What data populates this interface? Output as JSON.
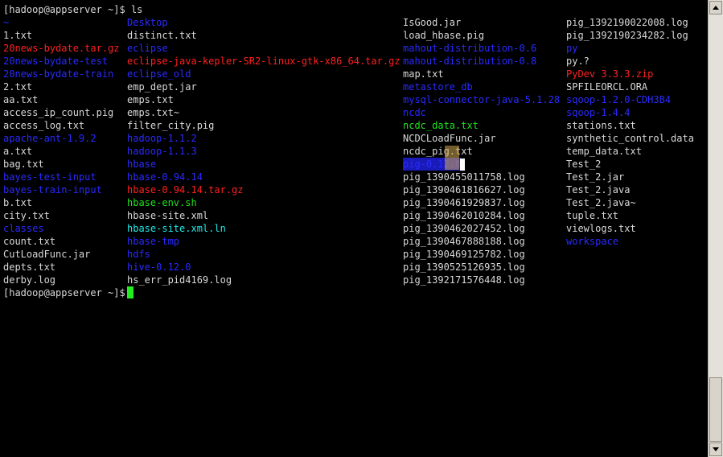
{
  "terminal": {
    "command_prompt": "[hadoop@appserver ~]$ ",
    "command": "ls",
    "final_prompt": "[hadoop@appserver ~]$ ",
    "columns": [
      [
        {
          "text": "~",
          "color": "blue"
        },
        {
          "text": "1.txt",
          "color": "white"
        },
        {
          "text": "20news-bydate.tar.gz",
          "color": "red"
        },
        {
          "text": "20news-bydate-test",
          "color": "blue"
        },
        {
          "text": "20news-bydate-train",
          "color": "blue"
        },
        {
          "text": "2.txt",
          "color": "white"
        },
        {
          "text": "aa.txt",
          "color": "white"
        },
        {
          "text": "access_ip_count.pig",
          "color": "white"
        },
        {
          "text": "access_log.txt",
          "color": "white"
        },
        {
          "text": "apache-ant-1.9.2",
          "color": "blue"
        },
        {
          "text": "a.txt",
          "color": "white"
        },
        {
          "text": "bag.txt",
          "color": "white"
        },
        {
          "text": "bayes-test-input",
          "color": "blue"
        },
        {
          "text": "bayes-train-input",
          "color": "blue"
        },
        {
          "text": "b.txt",
          "color": "white"
        },
        {
          "text": "city.txt",
          "color": "white"
        },
        {
          "text": "classes",
          "color": "blue"
        },
        {
          "text": "count.txt",
          "color": "white"
        },
        {
          "text": "CutLoadFunc.jar",
          "color": "white"
        },
        {
          "text": "depts.txt",
          "color": "white"
        },
        {
          "text": "derby.log",
          "color": "white"
        }
      ],
      [
        {
          "text": "Desktop",
          "color": "blue"
        },
        {
          "text": "distinct.txt",
          "color": "white"
        },
        {
          "text": "eclipse",
          "color": "blue"
        },
        {
          "text": "eclipse-java-kepler-SR2-linux-gtk-x86_64.tar.gz",
          "color": "red"
        },
        {
          "text": "eclipse_old",
          "color": "blue"
        },
        {
          "text": "emp_dept.jar",
          "color": "white"
        },
        {
          "text": "emps.txt",
          "color": "white"
        },
        {
          "text": "emps.txt~",
          "color": "white"
        },
        {
          "text": "filter_city.pig",
          "color": "white"
        },
        {
          "text": "hadoop-1.1.2",
          "color": "blue"
        },
        {
          "text": "hadoop-1.1.3",
          "color": "blue"
        },
        {
          "text": "hbase",
          "color": "blue"
        },
        {
          "text": "hbase-0.94.14",
          "color": "blue"
        },
        {
          "text": "hbase-0.94.14.tar.gz",
          "color": "red"
        },
        {
          "text": "hbase-env.sh",
          "color": "green"
        },
        {
          "text": "hbase-site.xml",
          "color": "white"
        },
        {
          "text": "hbase-site.xml.ln",
          "color": "cyan"
        },
        {
          "text": "hbase-tmp",
          "color": "blue"
        },
        {
          "text": "hdfs",
          "color": "blue"
        },
        {
          "text": "hive-0.12.0",
          "color": "blue"
        },
        {
          "text": "hs_err_pid4169.log",
          "color": "white"
        }
      ],
      [
        {
          "text": "IsGood.jar",
          "color": "white"
        },
        {
          "text": "load_hbase.pig",
          "color": "white"
        },
        {
          "text": "mahout-distribution-0.6",
          "color": "blue"
        },
        {
          "text": "mahout-distribution-0.8",
          "color": "blue"
        },
        {
          "text": "map.txt",
          "color": "white"
        },
        {
          "text": "metastore_db",
          "color": "blue"
        },
        {
          "text": "mysql-connector-java-5.1.28",
          "color": "blue"
        },
        {
          "text": "ncdc",
          "color": "blue"
        },
        {
          "text": "ncdc_data.txt",
          "color": "green"
        },
        {
          "text": "NCDCLoadFunc.jar",
          "color": "white"
        },
        {
          "text": "ncdc_pig.txt",
          "color": "white"
        },
        {
          "text": "pig-0.12.0",
          "color": "sel"
        },
        {
          "text": "pig_1390455011758.log",
          "color": "white"
        },
        {
          "text": "pig_1390461816627.log",
          "color": "white"
        },
        {
          "text": "pig_1390461929837.log",
          "color": "white"
        },
        {
          "text": "pig_1390462010284.log",
          "color": "white"
        },
        {
          "text": "pig_1390462027452.log",
          "color": "white"
        },
        {
          "text": "pig_1390467888188.log",
          "color": "white"
        },
        {
          "text": "pig_1390469125782.log",
          "color": "white"
        },
        {
          "text": "pig_1390525126935.log",
          "color": "white"
        },
        {
          "text": "pig_1392171576448.log",
          "color": "white"
        }
      ],
      [
        {
          "text": "pig_1392190022008.log",
          "color": "white"
        },
        {
          "text": "pig_1392190234282.log",
          "color": "white"
        },
        {
          "text": "py",
          "color": "blue"
        },
        {
          "text": "py.?",
          "color": "white"
        },
        {
          "text": "PyDev 3.3.3.zip",
          "color": "red"
        },
        {
          "text": "SPFILEORCL.ORA",
          "color": "white"
        },
        {
          "text": "sqoop-1.2.0-CDH3B4",
          "color": "blue"
        },
        {
          "text": "sqoop-1.4.4",
          "color": "blue"
        },
        {
          "text": "stations.txt",
          "color": "white"
        },
        {
          "text": "synthetic_control.data",
          "color": "white"
        },
        {
          "text": "temp_data.txt",
          "color": "white"
        },
        {
          "text": "Test_2",
          "color": "white"
        },
        {
          "text": "Test_2.jar",
          "color": "white"
        },
        {
          "text": "Test_2.java",
          "color": "white"
        },
        {
          "text": "Test_2.java~",
          "color": "white"
        },
        {
          "text": "tuple.txt",
          "color": "white"
        },
        {
          "text": "viewlogs.txt",
          "color": "white"
        },
        {
          "text": "workspace",
          "color": "blue"
        }
      ]
    ]
  },
  "scrollbar": {
    "up_icon": "arrow-up-icon",
    "down_icon": "arrow-down-icon"
  }
}
